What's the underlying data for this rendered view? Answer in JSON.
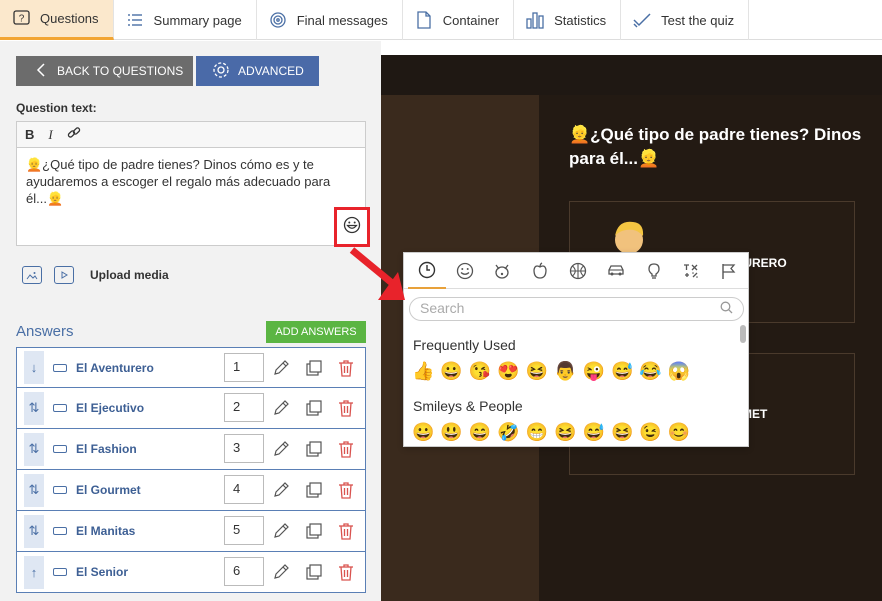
{
  "tabs": [
    {
      "label": "Questions",
      "icon": "question-icon"
    },
    {
      "label": "Summary page",
      "icon": "list-icon"
    },
    {
      "label": "Final messages",
      "icon": "target-icon"
    },
    {
      "label": "Container",
      "icon": "document-icon"
    },
    {
      "label": "Statistics",
      "icon": "bar-chart-icon"
    },
    {
      "label": "Test the quiz",
      "icon": "check-icon"
    }
  ],
  "left": {
    "back_label": "BACK TO QUESTIONS",
    "advanced_label": "ADVANCED",
    "question_label": "Question text:",
    "question_text": "👱¿Qué tipo de padre tienes? Dinos cómo es y te ayudaremos a escoger el regalo más adecuado para él...👱",
    "upload_label": "Upload media",
    "answers_title": "Answers",
    "add_answers_label": "ADD ANSWERS",
    "answers": [
      {
        "name": "El Aventurero",
        "order": "1",
        "handle": "↓"
      },
      {
        "name": "El Ejecutivo",
        "order": "2",
        "handle": "⇅"
      },
      {
        "name": "El Fashion",
        "order": "3",
        "handle": "⇅"
      },
      {
        "name": "El Gourmet",
        "order": "4",
        "handle": "⇅"
      },
      {
        "name": "El Manitas",
        "order": "5",
        "handle": "⇅"
      },
      {
        "name": "El Senior",
        "order": "6",
        "handle": "↑"
      }
    ]
  },
  "preview": {
    "title": "👱¿Qué tipo de padre tienes? Dinos para él...👱",
    "card1_label": "TURERO",
    "card2_label": "MET"
  },
  "picker": {
    "search_placeholder": "Search",
    "section1": "Frequently Used",
    "section2": "Smileys & People",
    "frequent": [
      "👍",
      "😀",
      "😘",
      "😍",
      "😆",
      "👨",
      "😜",
      "😅",
      "😂",
      "😱"
    ],
    "smileys": [
      "😀",
      "😃",
      "😄",
      "🤣",
      "😁",
      "😆",
      "😅",
      "😆",
      "😉",
      "😊"
    ],
    "categories": [
      "🕘",
      "☺",
      "🐶",
      "🍎",
      "🏀",
      "🚗",
      "💡",
      "🔣",
      "🏳"
    ]
  },
  "colors": {
    "accent": "#f2a533",
    "primary": "#4a6aa8",
    "green": "#5bb543",
    "red": "#e8232b",
    "delete": "#d9534f"
  }
}
